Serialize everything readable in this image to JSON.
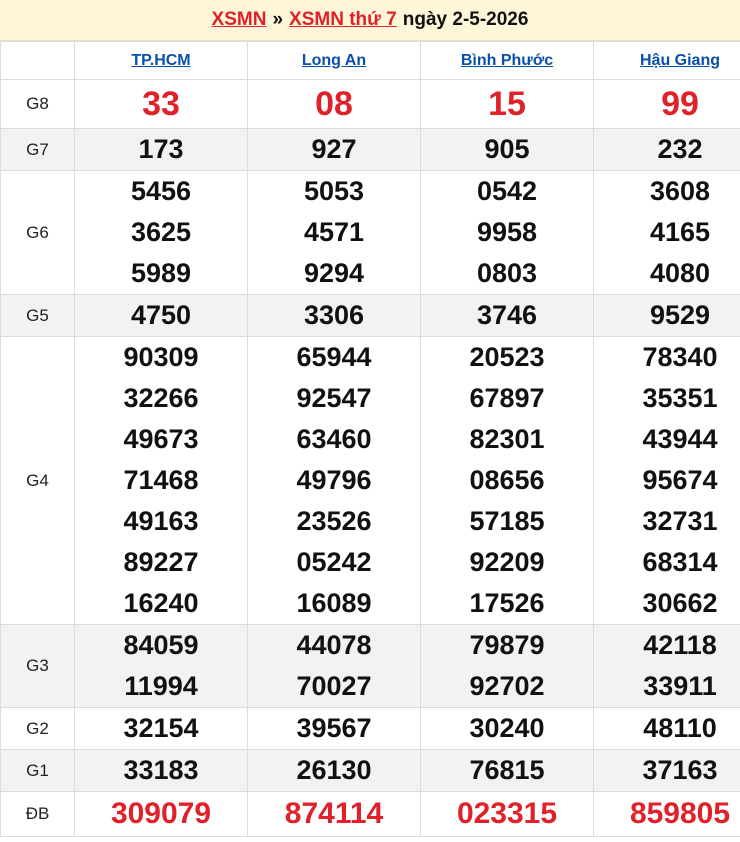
{
  "header": {
    "link1": "XSMN",
    "separator": "»",
    "link2": "XSMN thứ 7",
    "date_text": "ngày 2-5-2026"
  },
  "provinces": [
    "TP.HCM",
    "Long An",
    "Bình Phước",
    "Hậu Giang"
  ],
  "prizes": [
    {
      "label": "G8",
      "values": [
        [
          "33"
        ],
        [
          "08"
        ],
        [
          "15"
        ],
        [
          "99"
        ]
      ]
    },
    {
      "label": "G7",
      "values": [
        [
          "173"
        ],
        [
          "927"
        ],
        [
          "905"
        ],
        [
          "232"
        ]
      ]
    },
    {
      "label": "G6",
      "values": [
        [
          "5456",
          "3625",
          "5989"
        ],
        [
          "5053",
          "4571",
          "9294"
        ],
        [
          "0542",
          "9958",
          "0803"
        ],
        [
          "3608",
          "4165",
          "4080"
        ]
      ]
    },
    {
      "label": "G5",
      "values": [
        [
          "4750"
        ],
        [
          "3306"
        ],
        [
          "3746"
        ],
        [
          "9529"
        ]
      ]
    },
    {
      "label": "G4",
      "values": [
        [
          "90309",
          "32266",
          "49673",
          "71468",
          "49163",
          "89227",
          "16240"
        ],
        [
          "65944",
          "92547",
          "63460",
          "49796",
          "23526",
          "05242",
          "16089"
        ],
        [
          "20523",
          "67897",
          "82301",
          "08656",
          "57185",
          "92209",
          "17526"
        ],
        [
          "78340",
          "35351",
          "43944",
          "95674",
          "32731",
          "68314",
          "30662"
        ]
      ]
    },
    {
      "label": "G3",
      "values": [
        [
          "84059",
          "11994"
        ],
        [
          "44078",
          "70027"
        ],
        [
          "79879",
          "92702"
        ],
        [
          "42118",
          "33911"
        ]
      ]
    },
    {
      "label": "G2",
      "values": [
        [
          "32154"
        ],
        [
          "39567"
        ],
        [
          "30240"
        ],
        [
          "48110"
        ]
      ]
    },
    {
      "label": "G1",
      "values": [
        [
          "33183"
        ],
        [
          "26130"
        ],
        [
          "76815"
        ],
        [
          "37163"
        ]
      ]
    },
    {
      "label": "ĐB",
      "values": [
        [
          "309079"
        ],
        [
          "874114"
        ],
        [
          "023315"
        ],
        [
          "859805"
        ]
      ]
    }
  ],
  "colors": {
    "accent_red": "#e0212a",
    "link_blue": "#0a4fa8",
    "header_bg": "#fdf6d8",
    "row_shade": "#f2f2f2"
  }
}
